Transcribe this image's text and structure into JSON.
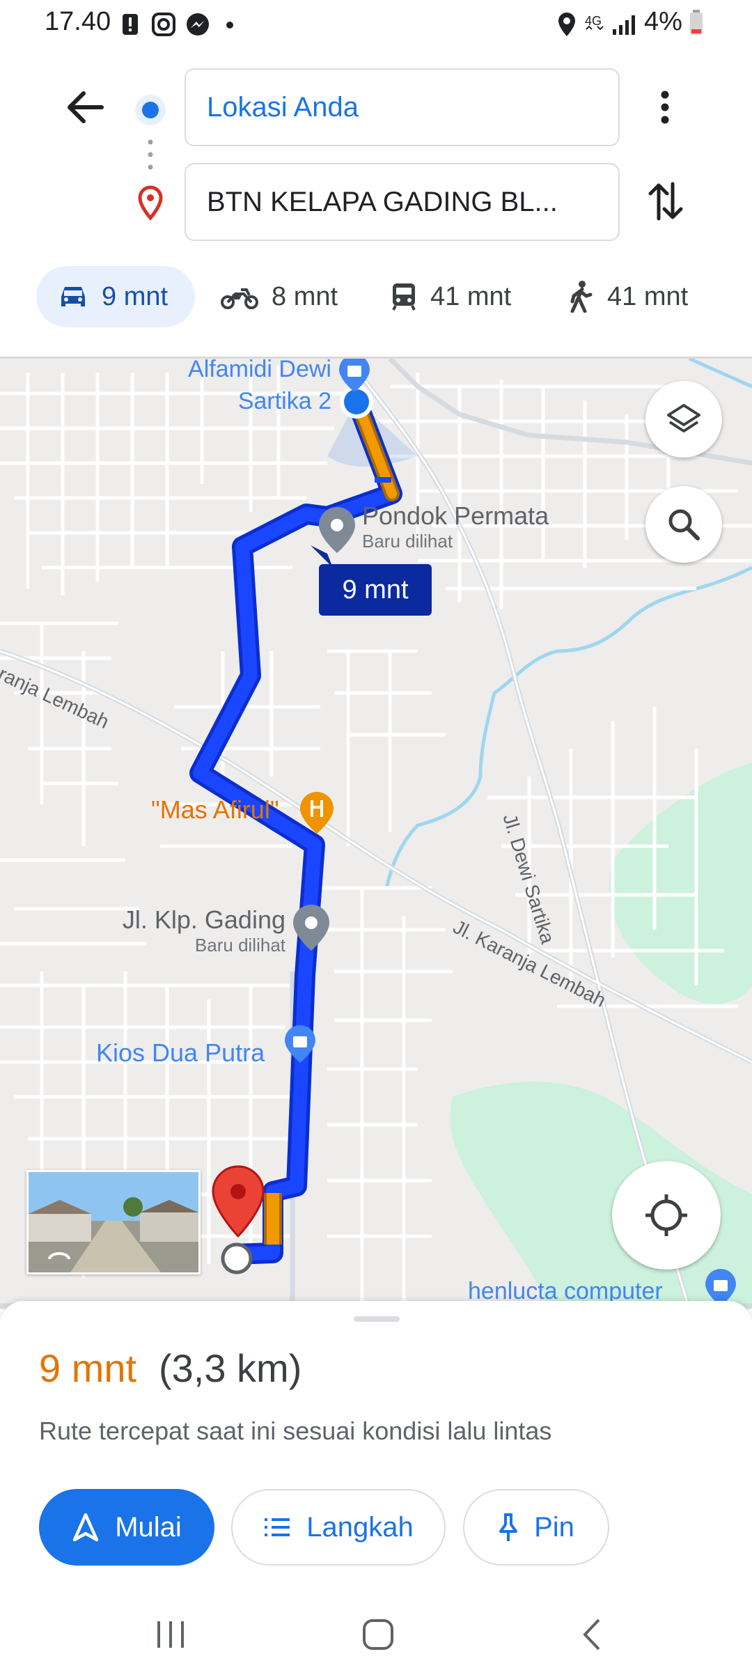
{
  "status_bar": {
    "time": "17.40",
    "network": "4G",
    "battery": "4%"
  },
  "header": {
    "origin_value": "Lokasi Anda",
    "destination_value": "BTN KELAPA GADING BL..."
  },
  "modes": [
    {
      "icon": "car-icon",
      "label": "9 mnt",
      "active": true
    },
    {
      "icon": "motorcycle-icon",
      "label": "8 mnt",
      "active": false
    },
    {
      "icon": "transit-icon",
      "label": "41 mnt",
      "active": false
    },
    {
      "icon": "walk-icon",
      "label": "41 mnt",
      "active": false
    }
  ],
  "map": {
    "places": {
      "alfamidi_line1": "Alfamidi Dewi",
      "alfamidi_line2": "Sartika 2",
      "pondok": "Pondok Permata",
      "pondok_sub": "Baru dilihat",
      "mas_afirul": "\"Mas Afirul\"",
      "klp_gading": "Jl. Klp. Gading",
      "klp_gading_sub": "Baru dilihat",
      "kios": "Kios Dua Putra",
      "henlucta": "henlucta computer"
    },
    "roads": {
      "karanja_left": "aranja Lembah",
      "karanja_right": "Jl. Karanja Lembah",
      "dewi_sartika": "Jl. Dewi Sartika"
    },
    "route_badge": "9 mnt",
    "colors": {
      "route": "#1a46ff",
      "traffic_slow": "#f29900",
      "park": "#ccf1dc",
      "water": "#9fd6ee",
      "poi_blue": "#4285f4",
      "poi_orange": "#f09300"
    }
  },
  "sheet": {
    "eta_time": "9 mnt",
    "eta_distance": "(3,3 km)",
    "route_note": "Rute tercepat saat ini sesuai kondisi lalu lintas",
    "buttons": {
      "start": "Mulai",
      "steps": "Langkah",
      "pin": "Pin"
    }
  }
}
